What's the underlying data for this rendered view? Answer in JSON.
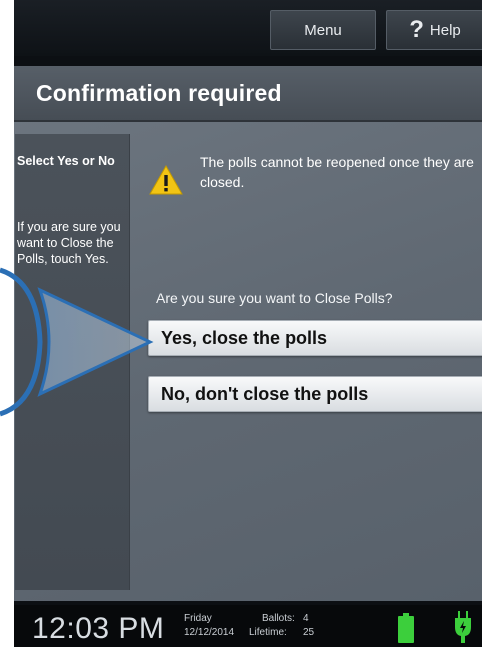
{
  "topbar": {
    "menu_label": "Menu",
    "help_label": "Help",
    "help_glyph": "?"
  },
  "page": {
    "title": "Confirmation required"
  },
  "sidebar": {
    "heading": "Select Yes or No",
    "instruction": "If you are sure you want to Close the Polls, touch Yes."
  },
  "warning": {
    "icon": "warning-triangle-icon",
    "text": "The polls cannot be reopened once they are closed."
  },
  "question": "Are you sure you want to Close Polls?",
  "buttons": {
    "yes": "Yes, close the polls",
    "no": "No, don't close the polls"
  },
  "status": {
    "time": "12:03 PM",
    "day": "Friday",
    "date": "12/12/2014",
    "ballots_label": "Ballots:",
    "ballots_value": "4",
    "lifetime_label": "Lifetime:",
    "lifetime_value": "25",
    "battery_icon": "battery-full-icon",
    "power_icon": "power-plug-icon",
    "status_color": "#3ccf3c"
  },
  "colors": {
    "warning": "#f2c414",
    "title_bg": "#4f565e"
  }
}
